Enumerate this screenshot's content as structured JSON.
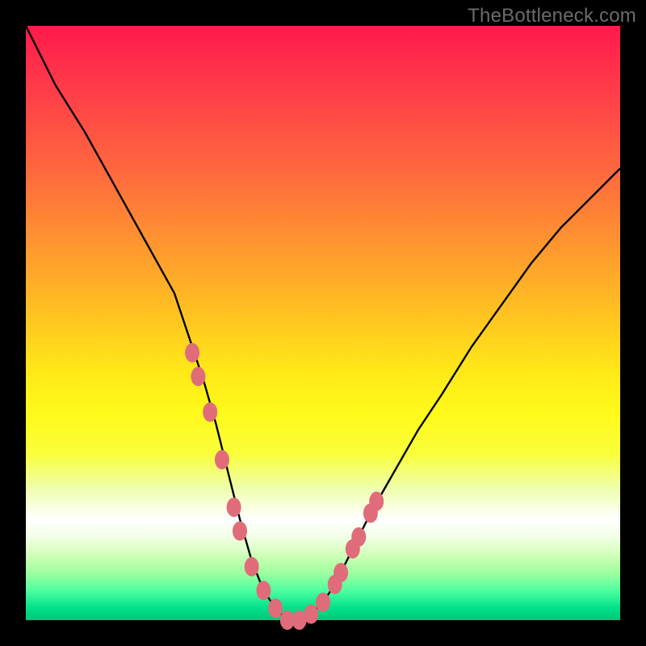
{
  "watermark": "TheBottleneck.com",
  "colors": {
    "curve": "#000000",
    "marker_fill": "#e06c7a",
    "marker_stroke": "#c85a68",
    "frame": "#000000"
  },
  "chart_data": {
    "type": "line",
    "title": "",
    "xlabel": "",
    "ylabel": "",
    "xlim": [
      0,
      100
    ],
    "ylim": [
      0,
      100
    ],
    "grid": false,
    "legend": false,
    "series": [
      {
        "name": "bottleneck-curve",
        "x": [
          0,
          5,
          10,
          15,
          20,
          25,
          28,
          30,
          32,
          34,
          36,
          38,
          40,
          42,
          44,
          46,
          48,
          50,
          52,
          55,
          58,
          62,
          66,
          70,
          75,
          80,
          85,
          90,
          95,
          100
        ],
        "values": [
          100,
          90,
          82,
          73,
          64,
          55,
          46,
          40,
          33,
          25,
          17,
          10,
          5,
          2,
          0,
          0,
          1,
          3,
          6,
          12,
          18,
          25,
          32,
          38,
          46,
          53,
          60,
          66,
          71,
          76
        ]
      }
    ],
    "markers": {
      "name": "highlight-points",
      "x": [
        28,
        29,
        31,
        33,
        35,
        36,
        38,
        40,
        42,
        44,
        46,
        48,
        50,
        52,
        53,
        55,
        56,
        58,
        59
      ],
      "values": [
        45,
        41,
        35,
        27,
        19,
        15,
        9,
        5,
        2,
        0,
        0,
        1,
        3,
        6,
        8,
        12,
        14,
        18,
        20
      ]
    }
  }
}
